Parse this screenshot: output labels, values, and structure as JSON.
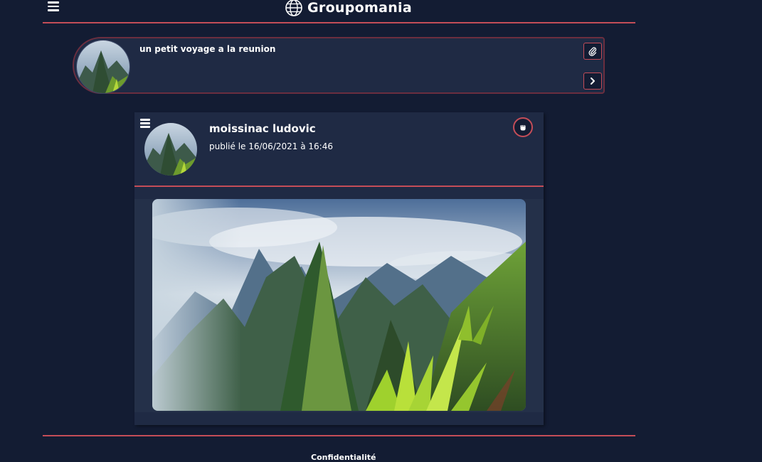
{
  "header": {
    "brand": "Groupomania",
    "menu_icon": "hamburger-menu-icon",
    "logo_icon": "globe-icon"
  },
  "composer": {
    "text": "un petit voyage a la reunion",
    "attach_icon": "paperclip-icon",
    "submit_icon": "chevron-right-icon"
  },
  "post": {
    "author": "moissinac ludovic",
    "date": "publié le 16/06/2021 à 16:46",
    "menu_icon": "hamburger-menu-icon",
    "like_icon": "fist-icon"
  },
  "footer": {
    "link": "Confidentialité"
  },
  "colors": {
    "background": "#131c33",
    "card": "#1f2a44",
    "accent": "#c44d58"
  }
}
